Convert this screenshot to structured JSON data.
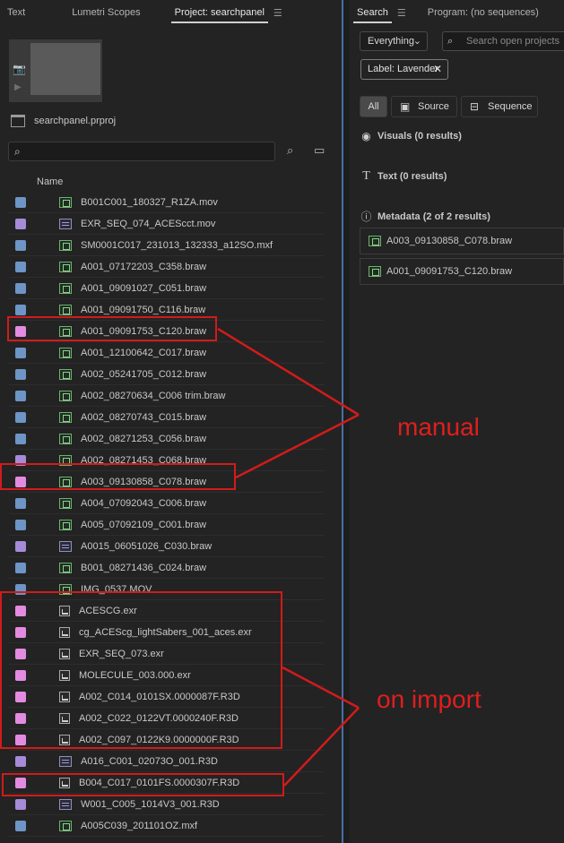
{
  "left_panel": {
    "tabs": [
      {
        "label": "Text",
        "active": false
      },
      {
        "label": "Lumetri Scopes",
        "active": false
      },
      {
        "label": "Project: searchpanel",
        "active": true
      }
    ],
    "tab_menu_icon": "hamburger-icon",
    "project_file": "searchpanel.prproj",
    "search_placeholder": "",
    "column_header": "Name",
    "files": [
      {
        "name": "B001C001_180327_R1ZA.mov",
        "label_color": "#6d95c6",
        "icon": "clip-icon"
      },
      {
        "name": "EXR_SEQ_074_ACEScct.mov",
        "label_color": "#a58bd8",
        "icon": "sequence-icon"
      },
      {
        "name": "SM0001C017_231013_132333_a12SO.mxf",
        "label_color": "#6d95c6",
        "icon": "clip-icon"
      },
      {
        "name": "A001_07172203_C358.braw",
        "label_color": "#6d95c6",
        "icon": "clip-icon"
      },
      {
        "name": "A001_09091027_C051.braw",
        "label_color": "#6d95c6",
        "icon": "clip-icon"
      },
      {
        "name": "A001_09091750_C116.braw",
        "label_color": "#6d95c6",
        "icon": "clip-icon"
      },
      {
        "name": "A001_09091753_C120.braw",
        "label_color": "#e38be0",
        "icon": "clip-icon"
      },
      {
        "name": "A001_12100642_C017.braw",
        "label_color": "#6d95c6",
        "icon": "clip-icon"
      },
      {
        "name": "A002_05241705_C012.braw",
        "label_color": "#6d95c6",
        "icon": "clip-icon"
      },
      {
        "name": "A002_08270634_C006 trim.braw",
        "label_color": "#6d95c6",
        "icon": "clip-icon"
      },
      {
        "name": "A002_08270743_C015.braw",
        "label_color": "#6d95c6",
        "icon": "clip-icon"
      },
      {
        "name": "A002_08271253_C056.braw",
        "label_color": "#6d95c6",
        "icon": "clip-icon"
      },
      {
        "name": "A002_08271453_C068.braw",
        "label_color": "#a58bd8",
        "icon": "clip-icon"
      },
      {
        "name": "A003_09130858_C078.braw",
        "label_color": "#e38be0",
        "icon": "clip-icon"
      },
      {
        "name": "A004_07092043_C006.braw",
        "label_color": "#6d95c6",
        "icon": "clip-icon"
      },
      {
        "name": "A005_07092109_C001.braw",
        "label_color": "#6d95c6",
        "icon": "clip-icon"
      },
      {
        "name": "A0015_06051026_C030.braw",
        "label_color": "#a58bd8",
        "icon": "sequence-icon"
      },
      {
        "name": "B001_08271436_C024.braw",
        "label_color": "#6d95c6",
        "icon": "clip-icon"
      },
      {
        "name": "IMG_0537.MOV",
        "label_color": "#6d95c6",
        "icon": "clip-icon"
      },
      {
        "name": "ACESCG.exr",
        "label_color": "#e38be0",
        "icon": "still-icon"
      },
      {
        "name": "cg_ACEScg_lightSabers_001_aces.exr",
        "label_color": "#e38be0",
        "icon": "still-icon"
      },
      {
        "name": "EXR_SEQ_073.exr",
        "label_color": "#e38be0",
        "icon": "still-icon"
      },
      {
        "name": "MOLECULE_003.000.exr",
        "label_color": "#e38be0",
        "icon": "still-icon"
      },
      {
        "name": "A002_C014_0101SX.0000087F.R3D",
        "label_color": "#e38be0",
        "icon": "still-icon"
      },
      {
        "name": "A002_C022_0122VT.0000240F.R3D",
        "label_color": "#e38be0",
        "icon": "still-icon"
      },
      {
        "name": "A002_C097_0122K9.0000000F.R3D",
        "label_color": "#e38be0",
        "icon": "still-icon"
      },
      {
        "name": "A016_C001_02073O_001.R3D",
        "label_color": "#a58bd8",
        "icon": "sequence-icon"
      },
      {
        "name": "B004_C017_0101FS.0000307F.R3D",
        "label_color": "#e38be0",
        "icon": "still-icon"
      },
      {
        "name": "W001_C005_1014V3_001.R3D",
        "label_color": "#a58bd8",
        "icon": "sequence-icon"
      },
      {
        "name": "A005C039_201101OZ.mxf",
        "label_color": "#6d95c6",
        "icon": "clip-icon"
      }
    ]
  },
  "right_panel": {
    "tabs": [
      {
        "label": "Search",
        "active": true
      },
      {
        "label": "Program: (no sequences)",
        "active": false
      }
    ],
    "scope_dropdown": "Everything",
    "search_placeholder": "Search open projects",
    "active_filter_chip": "Label: Lavender",
    "segments": {
      "all": "All",
      "source": "Source",
      "sequence": "Sequence"
    },
    "sections": {
      "visuals": "Visuals (0 results)",
      "text": "Text (0 results)",
      "metadata": "Metadata (2 of 2 results)"
    },
    "results": [
      {
        "name": "A003_09130858_C078.braw"
      },
      {
        "name": "A001_09091753_C120.braw"
      }
    ]
  },
  "annotations": {
    "manual": "manual",
    "on_import": "on import",
    "color": "#e01e1e"
  }
}
